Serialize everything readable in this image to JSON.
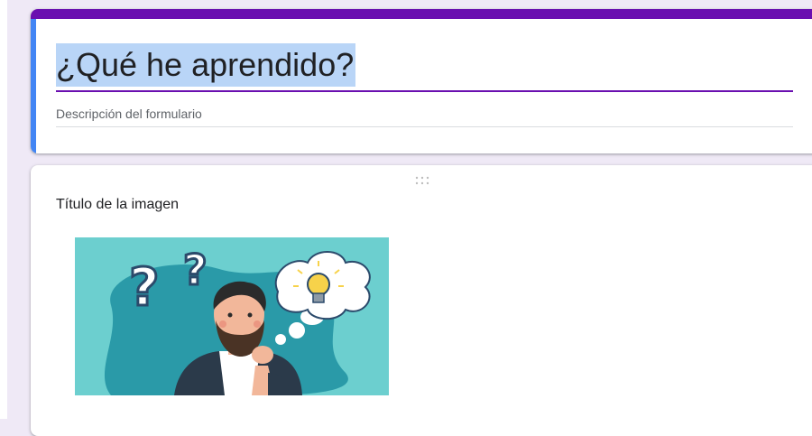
{
  "form": {
    "title": "¿Qué he aprendido?",
    "description_placeholder": "Descripción del formulario",
    "theme_color": "#6a0fb0",
    "focus_color": "#4285f4"
  },
  "image_item": {
    "title": "Título de la imagen",
    "image_description": "thinking-man-question-marks-lightbulb"
  }
}
